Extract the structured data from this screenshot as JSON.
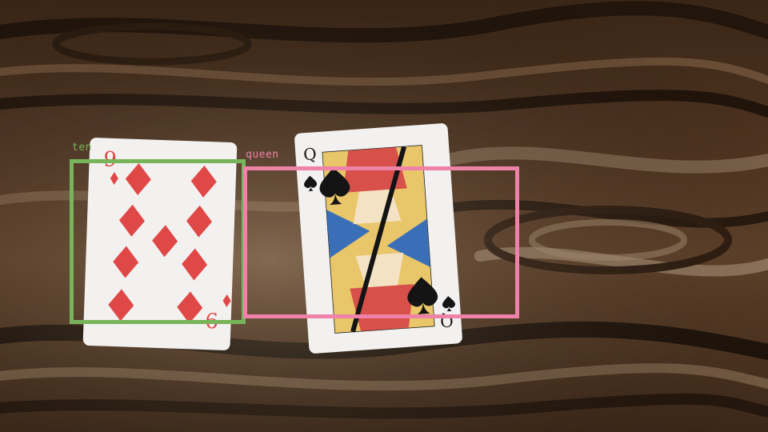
{
  "scene": {
    "description_icon": "wooden-table-photo",
    "colors": {
      "wood_dark": "#2a1a10",
      "wood_mid": "#6b4a30",
      "wood_light": "#b8a184",
      "card_face": "#f2f0ee",
      "diamond_red": "#e04848",
      "spade_black": "#141414"
    }
  },
  "detections": [
    {
      "label": "ten",
      "color": "#78b45a"
    },
    {
      "label": "queen",
      "color": "#ee82a8"
    }
  ],
  "cards": [
    {
      "rank": "9",
      "suit": "diamond-icon"
    },
    {
      "rank": "Q",
      "suit": "spade-icon"
    }
  ]
}
